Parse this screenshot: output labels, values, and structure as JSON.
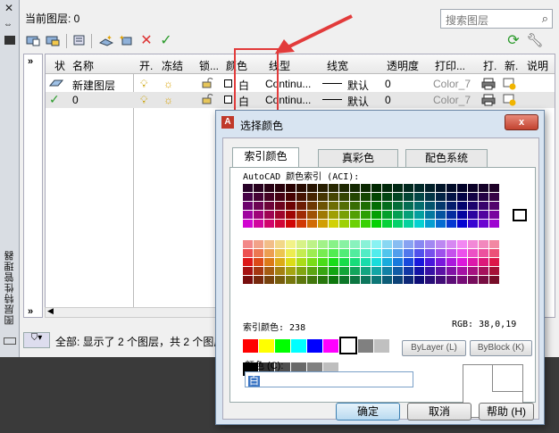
{
  "panel": {
    "current_layer": "当前图层: 0",
    "search_placeholder": "搜索图层",
    "vertical_title": "图层特性管理器",
    "columns": [
      "状",
      "名称",
      "开.",
      "冻结",
      "锁...",
      "颜色",
      "线型",
      "线宽",
      "透明度",
      "打印...",
      "打.",
      "新.",
      "说明"
    ],
    "rows": [
      {
        "name": "新建图层",
        "color": "白",
        "linetype": "Continu...",
        "lineweight": "默认",
        "transparency": "0",
        "plotstyle": "Color_7"
      },
      {
        "name": "0",
        "color": "白",
        "linetype": "Continu...",
        "lineweight": "默认",
        "transparency": "0",
        "plotstyle": "Color_7"
      }
    ],
    "status_text": "全部: 显示了 2 个图层，共 2 个图层",
    "icons": [
      "new-property-filter-icon",
      "new-group-filter-icon",
      "layer-states-icon",
      "new-layer-icon",
      "new-layer-vp-frozen-icon",
      "delete-layer-icon",
      "set-current-icon",
      "refresh-icon",
      "settings-icon"
    ]
  },
  "dialog": {
    "title": "选择颜色",
    "close_label": "x",
    "tabs": [
      "索引颜色",
      "真彩色",
      "配色系统"
    ],
    "aci_label": "AutoCAD 颜色索引 (ACI):",
    "index_label": "索引颜色: 238",
    "rgb_label": "RGB:      38,0,19",
    "bylayer_label": "ByLayer (L)",
    "byblock_label": "ByBlock (K)",
    "color_label": "颜色 (C):",
    "color_value": "白",
    "ok_label": "确定",
    "cancel_label": "取消",
    "help_label": "帮助 (H)",
    "std_colors": [
      "#ff0000",
      "#ffff00",
      "#00ff00",
      "#00ffff",
      "#0000ff",
      "#ff00ff",
      "#ffffff",
      "#808080",
      "#c0c0c0"
    ],
    "gray_colors": [
      "#000000",
      "#333333",
      "#505050",
      "#696969",
      "#808080",
      "#bebebe",
      "#ffffff"
    ]
  }
}
